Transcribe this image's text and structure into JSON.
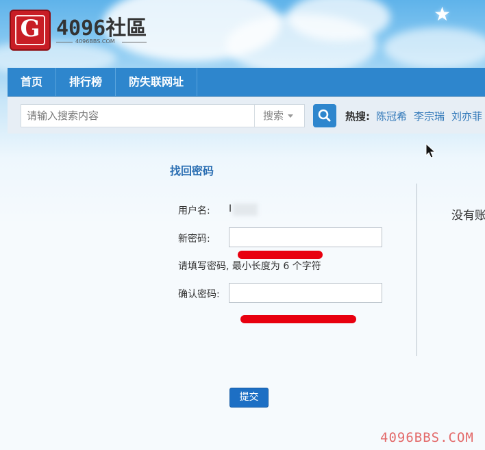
{
  "logo": {
    "title": "4096社區",
    "subtitle": "4096BBS.COM"
  },
  "nav": {
    "items": [
      {
        "label": "首页"
      },
      {
        "label": "排行榜"
      },
      {
        "label": "防失联网址"
      }
    ]
  },
  "search": {
    "placeholder": "请输入搜索内容",
    "type_label": "搜索",
    "button_icon": "search-icon",
    "hot_label": "热搜:",
    "hot_links": [
      "陈冠希",
      "李宗瑞",
      "刘亦菲"
    ]
  },
  "form": {
    "title": "找回密码",
    "username_label": "用户名:",
    "username_value": "I",
    "new_password_label": "新密码:",
    "new_password_hint": "请填写密码, 最小长度为 6 个字符",
    "confirm_password_label": "确认密码:",
    "submit_label": "提交"
  },
  "sidebar": {
    "text": "没有账"
  },
  "watermark": "4096BBS.COM",
  "colors": {
    "nav_bg": "#2e86cd",
    "title": "#2b6fb3",
    "link": "#2e76b8",
    "submit_bg": "#1d6fc4",
    "redaction": "#e8000f"
  }
}
